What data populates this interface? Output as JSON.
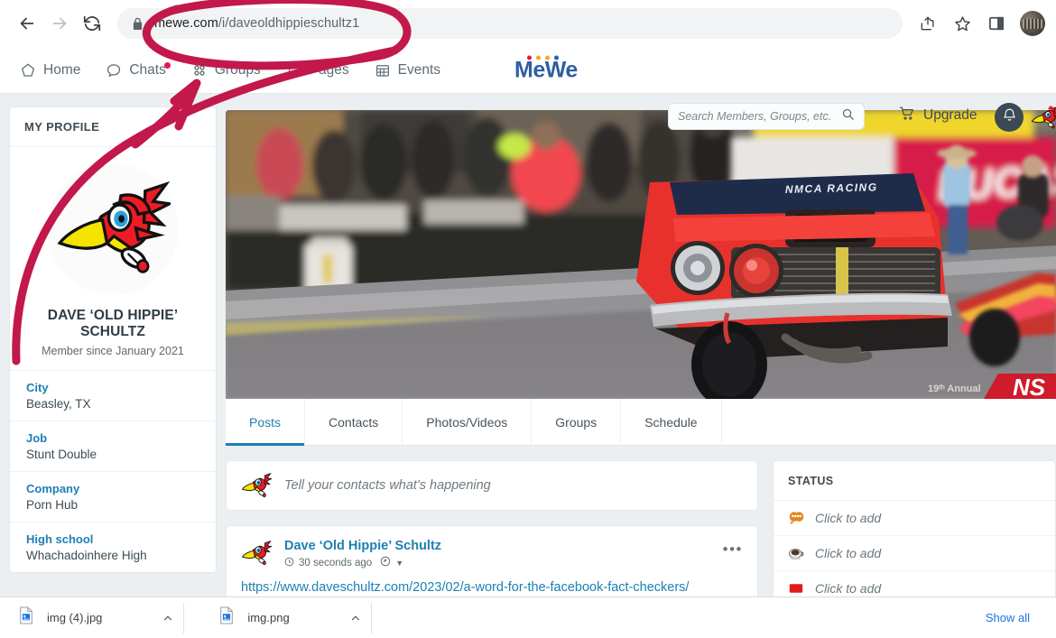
{
  "browser": {
    "back_label": "Back",
    "forward_label": "Forward",
    "reload_label": "Reload",
    "url_domain": "mewe.com",
    "url_path": "/i/daveoldhippieschultz1",
    "lock_icon": "lock-icon",
    "share_icon": "share-icon",
    "bookmark_icon": "star-icon",
    "sidepanel_icon": "side-panel-icon",
    "profile_icon": "chrome-profile-avatar"
  },
  "header": {
    "nav": [
      {
        "label": "Home",
        "icon": "home-pentagon-icon",
        "badge": false
      },
      {
        "label": "Chats",
        "icon": "chat-bubble-icon",
        "badge": true
      },
      {
        "label": "Groups",
        "icon": "groups-dots-icon",
        "badge": false
      },
      {
        "label": "Pages",
        "icon": "page-square-icon",
        "badge": false
      },
      {
        "label": "Events",
        "icon": "calendar-icon",
        "badge": false
      }
    ],
    "logo": {
      "text": "MeWe",
      "dot_colors": [
        "#e8174a",
        "#f5a623",
        "#f5a623",
        "#2e5fa3"
      ]
    },
    "search": {
      "placeholder": "Search Members, Groups, etc.",
      "value": "",
      "icon": "search-icon"
    },
    "upgrade": {
      "label": "Upgrade",
      "icon": "cart-icon"
    },
    "notifications": {
      "icon": "bell-icon"
    },
    "account_avatar": "user-avatar-woodpecker"
  },
  "sidebar": {
    "title": "MY PROFILE",
    "avatar": "profile-avatar-woodpecker",
    "name": "DAVE ‘OLD HIPPIE’ SCHULTZ",
    "member_since": "Member since January 2021",
    "fields": [
      {
        "label": "City",
        "value": "Beasley, TX"
      },
      {
        "label": "Job",
        "value": "Stunt Double"
      },
      {
        "label": "Company",
        "value": "Porn Hub"
      },
      {
        "label": "High school",
        "value": "Whachadoinhere High"
      }
    ]
  },
  "cover": {
    "alt": "drag-racing-car-wheelie-photo",
    "windshield_text": "NMCA RACING",
    "banner_text": "LUCAS O",
    "watermark_text": "19ᵗʰ Annual"
  },
  "tabs": [
    {
      "label": "Posts",
      "active": true
    },
    {
      "label": "Contacts",
      "active": false
    },
    {
      "label": "Photos/Videos",
      "active": false
    },
    {
      "label": "Groups",
      "active": false
    },
    {
      "label": "Schedule",
      "active": false
    }
  ],
  "composer": {
    "placeholder": "Tell your contacts what's happening",
    "avatar": "composer-avatar-woodpecker"
  },
  "post": {
    "author": "Dave ‘Old Hippie’ Schultz",
    "time": "30 seconds ago",
    "clock_icon": "clock-icon",
    "privacy_icon": "privacy-contacts-icon",
    "caret_icon": "chevron-down-icon",
    "menu_icon": "more-options-icon",
    "link": "https://www.daveschultz.com/2023/02/a-word-for-the-facebook-fact-checkers/"
  },
  "status_panel": {
    "title": "STATUS",
    "rows": [
      {
        "icon": "mood-mask-icon",
        "icon_color": "#e0881b",
        "label": "Click to add"
      },
      {
        "icon": "coffee-cup-icon",
        "icon_color": "#4a3a30",
        "label": "Click to add"
      },
      {
        "icon": "red-square-icon",
        "icon_color": "#e21b1b",
        "label": "Click to add"
      }
    ]
  },
  "downloads": {
    "items": [
      {
        "name": "img (4).jpg",
        "icon": "image-file-icon",
        "caret": "chevron-up-icon"
      },
      {
        "name": "img.png",
        "icon": "image-file-icon",
        "caret": "chevron-up-icon"
      }
    ],
    "show_all_label": "Show all"
  },
  "annotation": {
    "color": "#c2184b",
    "shapes": [
      "url-circle-highlight",
      "curved-arrow-to-groups"
    ]
  },
  "colors": {
    "accent_blue": "#1d7fb3",
    "page_bg": "#eceff1",
    "annotation_red": "#c2184b",
    "link_blue": "#1a73e8"
  }
}
